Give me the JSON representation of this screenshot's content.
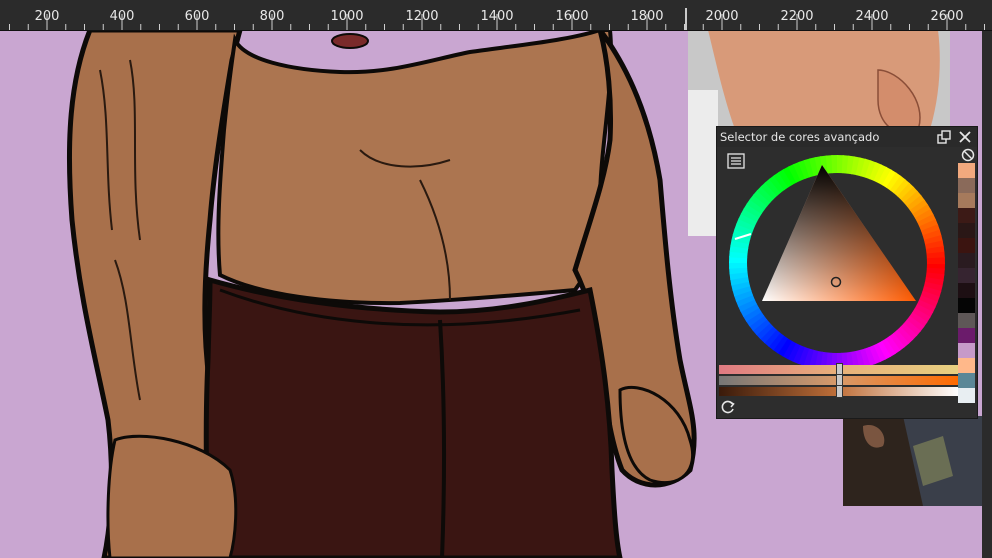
{
  "ruler": {
    "labels": [
      "200",
      "400",
      "600",
      "800",
      "1000",
      "1200",
      "1400",
      "1600",
      "1800",
      "2000",
      "2200",
      "2400",
      "2600"
    ]
  },
  "canvas": {
    "background": "#c9a6d1",
    "skin_color": "#a8704b",
    "pants_color": "#3a1512",
    "outline_color": "#0d0a08"
  },
  "color_selector": {
    "title": "Selector de cores avançado",
    "selected_color": "#f6e7e1",
    "palette": [
      "#f2a97e",
      "#8a6a5a",
      "#a67a5c",
      "#3c1a16",
      "#2a1716",
      "#3b1410",
      "#2a1b20",
      "#362430",
      "#1d0f13",
      "#050505",
      "#5e5757",
      "#6b1b6b",
      "#c69ac9",
      "#ffb88a",
      "#5b8797",
      "#e8eef2"
    ],
    "icons": {
      "float": "float-icon",
      "close": "close-icon",
      "reset": "ban-icon",
      "menu": "menu-icon",
      "refresh": "refresh-icon"
    }
  }
}
